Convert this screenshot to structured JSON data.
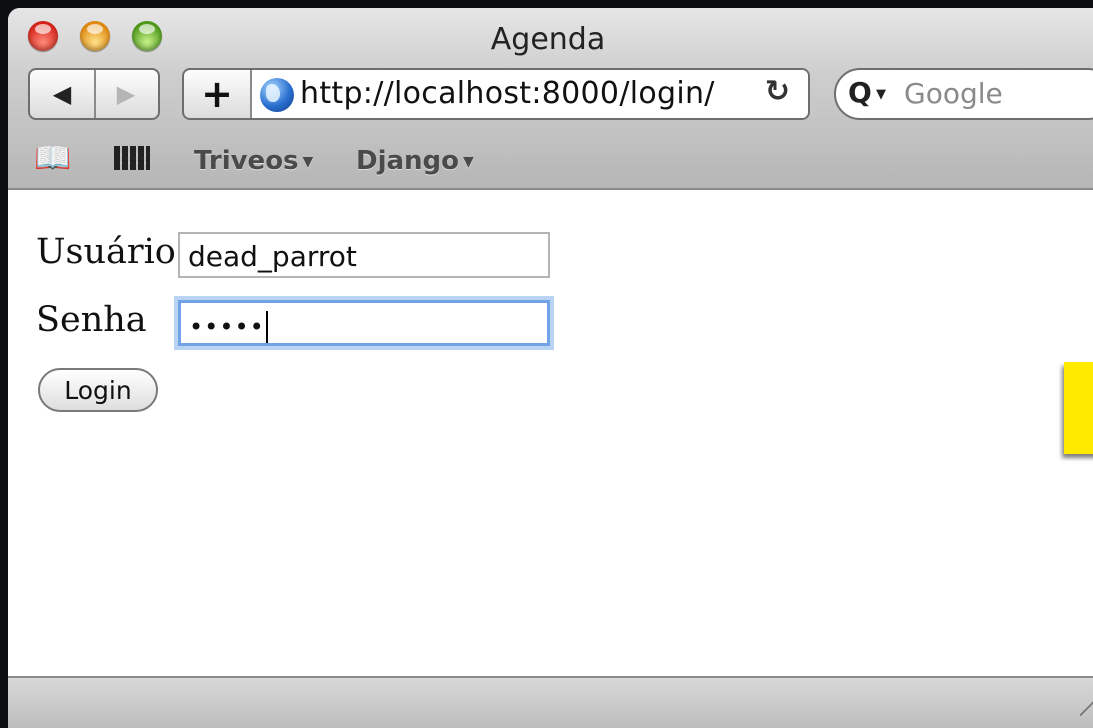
{
  "window": {
    "title": "Agenda"
  },
  "toolbar": {
    "back_icon": "back-arrow-icon",
    "forward_icon": "forward-arrow-icon",
    "add_bookmark_label": "+",
    "url": "http://localhost:8000/login/",
    "reload_glyph": "↻",
    "search_placeholder": "Google"
  },
  "bookmarks": {
    "items": [
      {
        "label": "Triveos"
      },
      {
        "label": "Django"
      }
    ]
  },
  "form": {
    "user_label": "Usuário",
    "user_value": "dead_parrot",
    "password_label": "Senha",
    "password_masked": "•••••",
    "login_label": "Login"
  },
  "colors": {
    "focus_ring": "#6fa3e6",
    "note": "#ffea00"
  }
}
